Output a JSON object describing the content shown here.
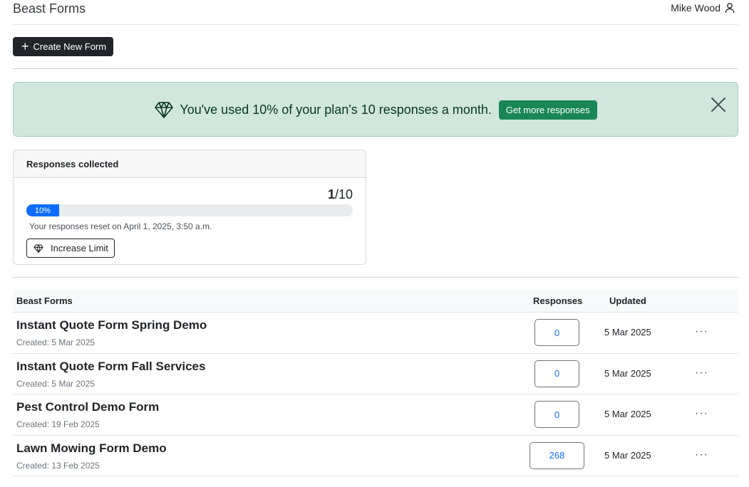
{
  "header": {
    "title": "Beast Forms",
    "user_name": "Mike Wood"
  },
  "toolbar": {
    "create_label": "Create New Form"
  },
  "banner": {
    "message": "You've used 10% of your plan's 10 responses a month.",
    "cta_label": "Get more responses",
    "bg_color": "#d1e7dd",
    "cta_color": "#198754"
  },
  "usage": {
    "title": "Responses collected",
    "used": "1",
    "limit_text": "/10",
    "percent": 10,
    "percent_label": "10%",
    "reset_text": "Your responses reset on April 1, 2025, 3:50 a.m.",
    "increase_label": "Increase Limit",
    "bar_color": "#0d6efd"
  },
  "forms_table": {
    "headers": {
      "name": "Beast Forms",
      "responses": "Responses",
      "updated": "Updated"
    },
    "rows": [
      {
        "name": "Instant Quote Form Spring Demo",
        "created": "Created: 5 Mar 2025",
        "responses": "0",
        "updated": "5 Mar 2025",
        "more": "···"
      },
      {
        "name": "Instant Quote Form Fall Services",
        "created": "Created: 5 Mar 2025",
        "responses": "0",
        "updated": "5 Mar 2025",
        "more": "···"
      },
      {
        "name": "Pest Control Demo Form",
        "created": "Created: 19 Feb 2025",
        "responses": "0",
        "updated": "5 Mar 2025",
        "more": "···"
      },
      {
        "name": "Lawn Mowing Form Demo",
        "created": "Created: 13 Feb 2025",
        "responses": "268",
        "updated": "5 Mar 2025",
        "more": "···"
      }
    ]
  }
}
